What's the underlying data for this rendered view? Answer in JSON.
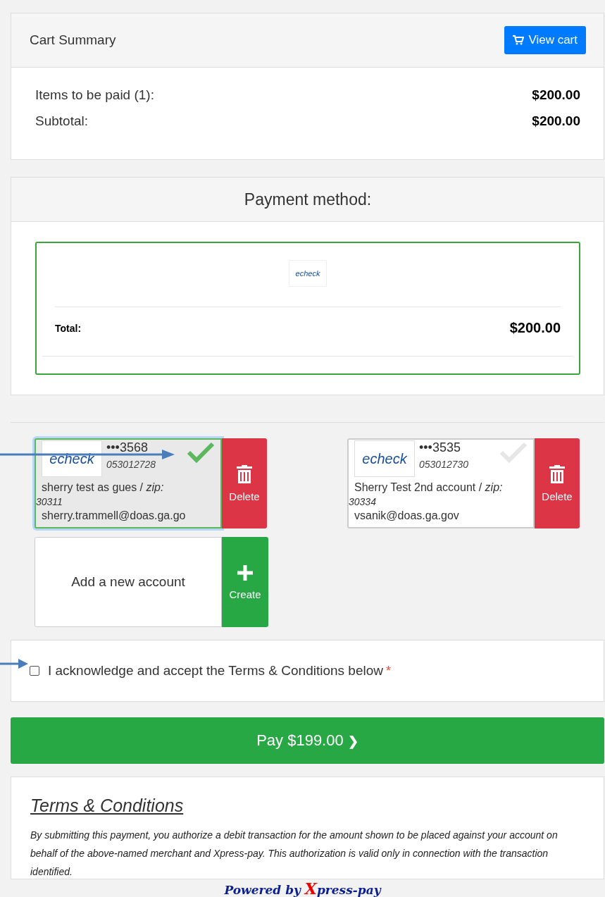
{
  "cart_summary": {
    "title": "Cart Summary",
    "view_cart_button": "View cart",
    "lines": [
      {
        "label": "Items to be paid (1):",
        "value": "$200.00"
      },
      {
        "label": "Subtotal:",
        "value": "$200.00"
      }
    ]
  },
  "payment_method": {
    "title": "Payment method:",
    "logo_text": "echeck",
    "total_label": "Total:",
    "total_value": "$200.00"
  },
  "accounts": [
    {
      "logo_text": "echeck",
      "masked": "•••3568",
      "routing": "053012728",
      "name": "sherry test as gues / *zip:*",
      "zip": "30311",
      "email": "sherry.trammell@doas.ga.go",
      "selected": true,
      "delete_label": "Delete"
    },
    {
      "logo_text": "echeck",
      "masked": "•••3535",
      "routing": "053012730",
      "name": "Sherry Test 2nd account / *zip:*",
      "zip": "30334",
      "email": "vsanik@doas.ga.gov",
      "selected": false,
      "delete_label": "Delete"
    }
  ],
  "add_account": {
    "label": "Add a new account",
    "button": "Create"
  },
  "terms_checkbox": {
    "label": "I acknowledge and accept the Terms & Conditions below",
    "required_mark": "*",
    "checked": false
  },
  "pay_button": "Pay $199.00",
  "chevron": "❯",
  "terms": {
    "title": "Terms & Conditions",
    "text": "By submitting this payment, you authorize a debit transaction for the amount shown to be placed against your account on behalf of the above-named merchant and Xpress-pay. This authorization is valid only in connection with the transaction identified."
  },
  "footer": {
    "prefix": "Powered by ",
    "brand_initial": "X",
    "brand_rest": "press-pay"
  }
}
